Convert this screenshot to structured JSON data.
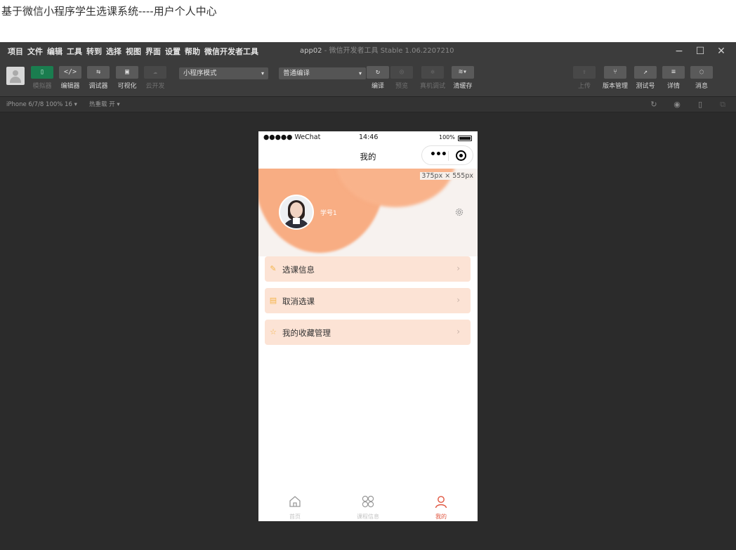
{
  "caption": "基于微信小程序学生选课系统----用户个人中心",
  "menubar": {
    "items": [
      "项目",
      "文件",
      "编辑",
      "工具",
      "转到",
      "选择",
      "视图",
      "界面",
      "设置",
      "帮助",
      "微信开发者工具"
    ],
    "app_name": "app02",
    "app_subtitle": " - 微信开发者工具 Stable 1.06.2207210"
  },
  "window_controls": {
    "minimize": "−",
    "maximize": "☐",
    "close": "✕"
  },
  "toolbar": {
    "simulator": "模拟器",
    "editor": "编辑器",
    "debugger": "调试器",
    "visual": "可视化",
    "cloud": "云开发",
    "mode_select": "小程序模式",
    "compile_select": "普通编译",
    "compile": "编译",
    "preview": "预览",
    "real_debug": "真机调试",
    "clear_cache": "清缓存",
    "upload": "上传",
    "version": "版本管理",
    "test_id": "测试号",
    "details": "详情",
    "messages": "消息"
  },
  "devicebar": {
    "device": "iPhone 6/7/8 100% 16 ▾",
    "hot_reload": "热重载 开 ▾"
  },
  "phone": {
    "status": {
      "carrier": "●●●●● WeChat",
      "time": "14:46",
      "battery": "100%"
    },
    "nav_title": "我的",
    "size_hint": "375px × 555px",
    "profile": {
      "student_id": "学号1"
    },
    "menu": [
      {
        "label": "选课信息",
        "icon": "edit-icon"
      },
      {
        "label": "取消选课",
        "icon": "document-icon"
      },
      {
        "label": "我的收藏管理",
        "icon": "star-icon"
      }
    ],
    "tabs": [
      {
        "label": "首页",
        "icon": "home-icon"
      },
      {
        "label": "课程信息",
        "icon": "grid-icon"
      },
      {
        "label": "我的",
        "icon": "user-icon"
      }
    ]
  },
  "colors": {
    "accent": "#f8ad83",
    "tab_active": "#e0553f",
    "menu_bg": "#fce3d5"
  }
}
